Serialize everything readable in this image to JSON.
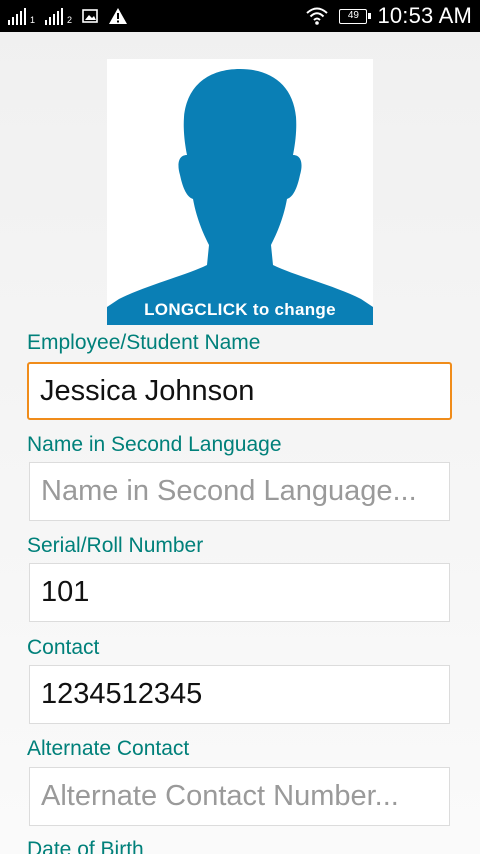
{
  "status_bar": {
    "sim1_label": "1",
    "sim2_label": "2",
    "battery_level": "49",
    "time": "10:53 AM",
    "icons": [
      "signal-icon",
      "signal-icon",
      "image-icon",
      "warning-icon",
      "wifi-icon",
      "battery-icon"
    ]
  },
  "photo": {
    "caption": "LONGCLICK to change",
    "silhouette_color": "#0a7fb5"
  },
  "form": {
    "name_label": "Employee/Student Name",
    "name_value": "Jessica Johnson",
    "second_lang_label": "Name in Second Language",
    "second_lang_placeholder": "Name in Second Language...",
    "serial_label": "Serial/Roll Number",
    "serial_value": "101",
    "contact_label": "Contact",
    "contact_value": "1234512345",
    "alt_contact_label": "Alternate Contact",
    "alt_contact_placeholder": "Alternate Contact Number...",
    "dob_label": "Date of Birth"
  },
  "colors": {
    "accent": "#00807a",
    "focus_border": "#f08c1a"
  }
}
